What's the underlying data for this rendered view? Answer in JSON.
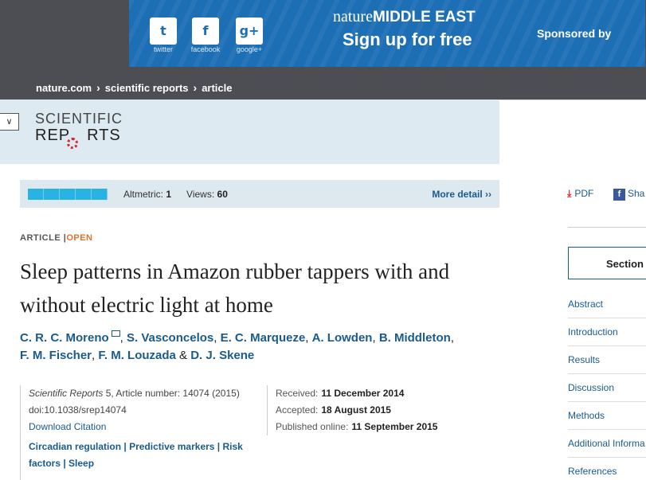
{
  "ad": {
    "social": [
      {
        "label": "twitter",
        "glyph": "t"
      },
      {
        "label": "facebook",
        "glyph": "f"
      },
      {
        "label": "google+",
        "glyph": "g+"
      }
    ],
    "brand_nature": "nature",
    "brand_region": "MIDDLE EAST",
    "cta": "Sign up for free",
    "sponsor": "Sponsored by"
  },
  "breadcrumb": {
    "items": [
      "nature.com",
      "scientific reports",
      "article"
    ],
    "separator": "›"
  },
  "journal": {
    "menu_glyph": "∨",
    "logo_line1": "SCIENTIFIC",
    "logo_line2": "REP RTS"
  },
  "metrics": {
    "altmetric_label": "Altmetric:",
    "altmetric_value": "1",
    "views_label": "Views:",
    "views_value": "60",
    "more_detail": "More detail ››"
  },
  "article": {
    "type": "ARTICLE",
    "divider": "|",
    "access": "OPEN",
    "title": "Sleep patterns in Amazon rubber tappers with and without electric light at home",
    "authors_line1": [
      "C. R. C. Moreno",
      "S. Vasconcelos",
      "E. C. Marqueze",
      "A. Lowden",
      "B. Middleton"
    ],
    "authors_line2": [
      "F. M. Fischer",
      "F. M. Louzada",
      "D. J. Skene"
    ],
    "journal_name": "Scientific Reports",
    "journal_rest": " 5, Article number: 14074 (2015)",
    "doi": "doi:10.1038/srep14074",
    "download_citation": "Download Citation",
    "subjects": [
      "Circadian regulation",
      "Predictive markers",
      "Risk factors",
      "Sleep"
    ],
    "received_label": "Received:",
    "received_date": "11 December 2014",
    "accepted_label": "Accepted:",
    "accepted_date": "18 August 2015",
    "published_label": "Published online:",
    "published_date": "11 September 2015"
  },
  "sidebar": {
    "pdf_label": "PDF",
    "share_label": "Sha",
    "sections_title": "Section",
    "sections": [
      "Abstract",
      "Introduction",
      "Results",
      "Discussion",
      "Methods",
      "Additional Informa",
      "References"
    ]
  },
  "colors": {
    "banner_blue": "#1c6fb5",
    "dark_bar": "#4d4e53",
    "link_blue": "#1a5b8e",
    "open_orange": "#e2712c",
    "header_bg": "#ddeaf1",
    "altmetric_cyan": "#27b4e5"
  }
}
